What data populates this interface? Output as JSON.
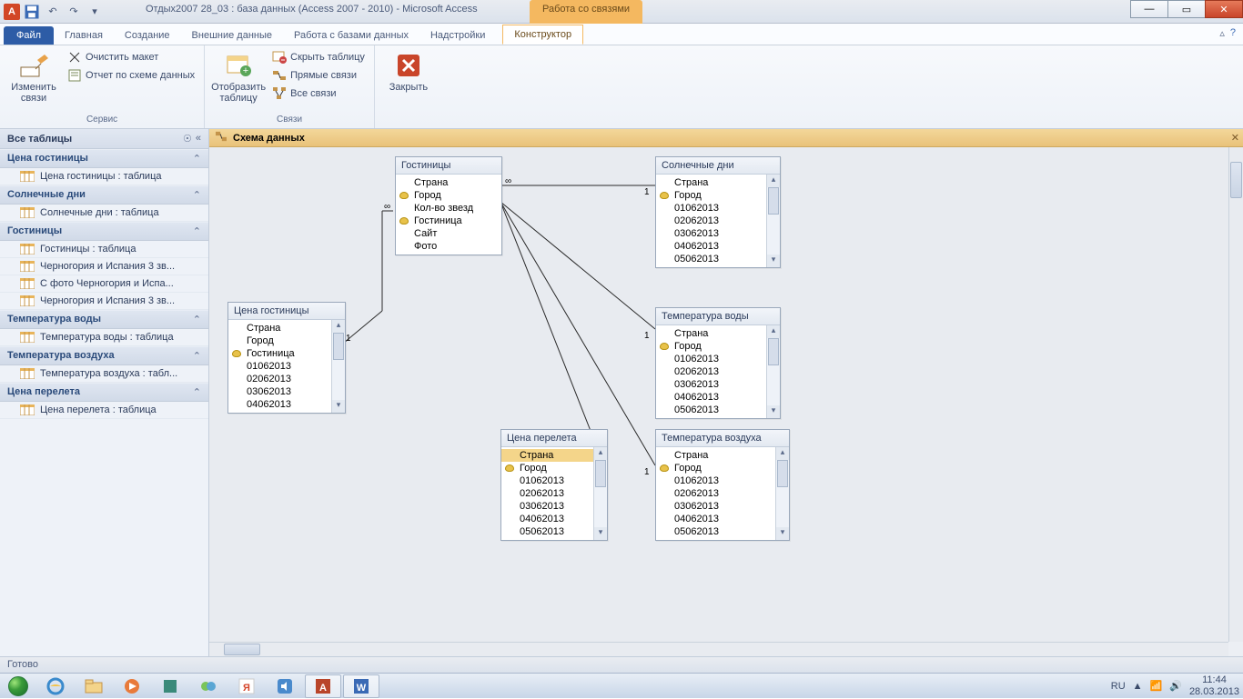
{
  "title": "Отдых2007 28_03 : база данных (Access 2007 - 2010)  -  Microsoft Access",
  "context_tab": "Работа со связями",
  "tabs": {
    "file": "Файл",
    "home": "Главная",
    "create": "Создание",
    "external": "Внешние данные",
    "dbtools": "Работа с базами данных",
    "addins": "Надстройки",
    "design": "Конструктор"
  },
  "ribbon": {
    "edit_rel": "Изменить связи",
    "clear_layout": "Очистить макет",
    "rel_report": "Отчет по схеме данных",
    "group_service": "Сервис",
    "show_table": "Отобразить таблицу",
    "hide_table": "Скрыть таблицу",
    "direct_rel": "Прямые связи",
    "all_rel": "Все связи",
    "group_rel": "Связи",
    "close": "Закрыть"
  },
  "nav": {
    "title": "Все таблицы",
    "groups": [
      {
        "name": "Цена гостиницы",
        "items": [
          "Цена гостиницы : таблица"
        ]
      },
      {
        "name": "Солнечные дни",
        "items": [
          "Солнечные дни : таблица"
        ]
      },
      {
        "name": "Гостиницы",
        "items": [
          "Гостиницы : таблица",
          "Черногория и Испания 3 зв...",
          "С фото Черногория и Испа...",
          "Черногория и Испания 3 зв..."
        ]
      },
      {
        "name": "Температура воды",
        "items": [
          "Температура воды : таблица"
        ]
      },
      {
        "name": "Температура воздуха",
        "items": [
          "Температура воздуха : табл..."
        ]
      },
      {
        "name": "Цена перелета",
        "items": [
          "Цена перелета : таблица"
        ]
      }
    ]
  },
  "doc_tab": "Схема данных",
  "tables": {
    "hotels": {
      "title": "Гостиницы",
      "fields": [
        {
          "n": "Страна",
          "k": false
        },
        {
          "n": "Город",
          "k": true
        },
        {
          "n": "Кол-во звезд",
          "k": false
        },
        {
          "n": "Гостиница",
          "k": true
        },
        {
          "n": "Сайт",
          "k": false
        },
        {
          "n": "Фото",
          "k": false
        }
      ]
    },
    "sunny": {
      "title": "Солнечные дни",
      "fields": [
        {
          "n": "Страна",
          "k": false
        },
        {
          "n": "Город",
          "k": true
        },
        {
          "n": "01062013",
          "k": false
        },
        {
          "n": "02062013",
          "k": false
        },
        {
          "n": "03062013",
          "k": false
        },
        {
          "n": "04062013",
          "k": false
        },
        {
          "n": "05062013",
          "k": false
        }
      ]
    },
    "price_hotel": {
      "title": "Цена гостиницы",
      "fields": [
        {
          "n": "Страна",
          "k": false
        },
        {
          "n": "Город",
          "k": false
        },
        {
          "n": "Гостиница",
          "k": true
        },
        {
          "n": "01062013",
          "k": false
        },
        {
          "n": "02062013",
          "k": false
        },
        {
          "n": "03062013",
          "k": false
        },
        {
          "n": "04062013",
          "k": false
        }
      ]
    },
    "water": {
      "title": "Температура воды",
      "fields": [
        {
          "n": "Страна",
          "k": false
        },
        {
          "n": "Город",
          "k": true
        },
        {
          "n": "01062013",
          "k": false
        },
        {
          "n": "02062013",
          "k": false
        },
        {
          "n": "03062013",
          "k": false
        },
        {
          "n": "04062013",
          "k": false
        },
        {
          "n": "05062013",
          "k": false
        }
      ]
    },
    "flight": {
      "title": "Цена перелета",
      "selected": 0,
      "fields": [
        {
          "n": "Страна",
          "k": false
        },
        {
          "n": "Город",
          "k": true
        },
        {
          "n": "01062013",
          "k": false
        },
        {
          "n": "02062013",
          "k": false
        },
        {
          "n": "03062013",
          "k": false
        },
        {
          "n": "04062013",
          "k": false
        },
        {
          "n": "05062013",
          "k": false
        }
      ]
    },
    "air": {
      "title": "Температура воздуха",
      "fields": [
        {
          "n": "Страна",
          "k": false
        },
        {
          "n": "Город",
          "k": true
        },
        {
          "n": "01062013",
          "k": false
        },
        {
          "n": "02062013",
          "k": false
        },
        {
          "n": "03062013",
          "k": false
        },
        {
          "n": "04062013",
          "k": false
        },
        {
          "n": "05062013",
          "k": false
        }
      ]
    }
  },
  "rel_labels": {
    "one": "1",
    "many": "∞"
  },
  "status": "Готово",
  "tray": {
    "lang": "RU",
    "time": "11:44",
    "date": "28.03.2013"
  }
}
